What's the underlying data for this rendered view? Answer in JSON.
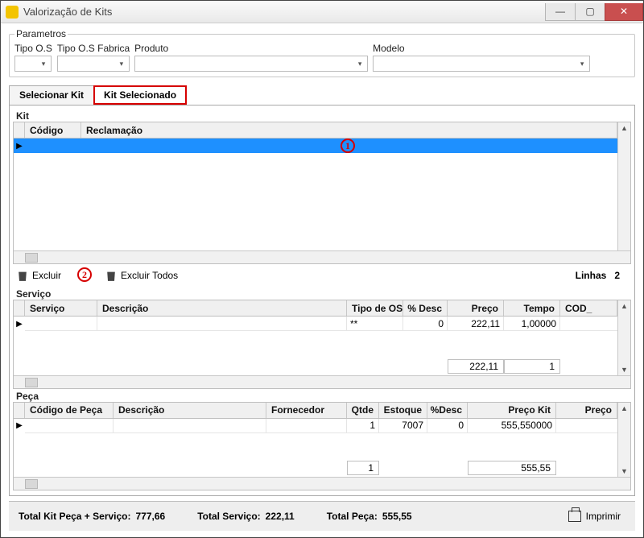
{
  "window": {
    "title": "Valorização de Kits"
  },
  "parametros": {
    "legend": "Parametros",
    "tipo_os": "Tipo O.S",
    "tipo_os_fab": "Tipo O.S Fabrica",
    "produto": "Produto",
    "modelo": "Modelo"
  },
  "tabs": {
    "selecionar": "Selecionar Kit",
    "selecionado": "Kit Selecionado"
  },
  "kit": {
    "title": "Kit",
    "col_codigo": "Código",
    "col_reclamacao": "Reclamação"
  },
  "toolbar": {
    "excluir": "Excluir",
    "excluir_todos": "Excluir Todos",
    "linhas_label": "Linhas",
    "linhas_val": "2"
  },
  "servico": {
    "title": "Serviço",
    "cols": {
      "servico": "Serviço",
      "descricao": "Descrição",
      "tipo_os": "Tipo de OS",
      "pdesc": "% Desc",
      "preco": "Preço",
      "tempo": "Tempo",
      "cod": "COD_"
    },
    "row": {
      "tipo_os": "**",
      "pdesc": "0",
      "preco": "222,11",
      "tempo": "1,00000"
    },
    "totals": {
      "preco": "222,11",
      "tempo": "1"
    }
  },
  "peca": {
    "title": "Peça",
    "cols": {
      "codigo": "Código de Peça",
      "descricao": "Descrição",
      "fornecedor": "Fornecedor",
      "qtde": "Qtde",
      "estoque": "Estoque",
      "pdesc": "%Desc",
      "preco_kit": "Preço Kit",
      "preco": "Preço"
    },
    "row": {
      "qtde": "1",
      "estoque": "7007",
      "pdesc": "0",
      "preco_kit": "555,550000"
    },
    "totals": {
      "qtde": "1",
      "preco_kit": "555,55"
    }
  },
  "footer": {
    "total_kit_lbl": "Total Kit Peça + Serviço:",
    "total_kit_val": "777,66",
    "total_servico_lbl": "Total Serviço:",
    "total_servico_val": "222,11",
    "total_peca_lbl": "Total Peça:",
    "total_peca_val": "555,55",
    "imprimir": "Imprimir"
  },
  "annotations": {
    "a1": "1",
    "a2": "2"
  }
}
